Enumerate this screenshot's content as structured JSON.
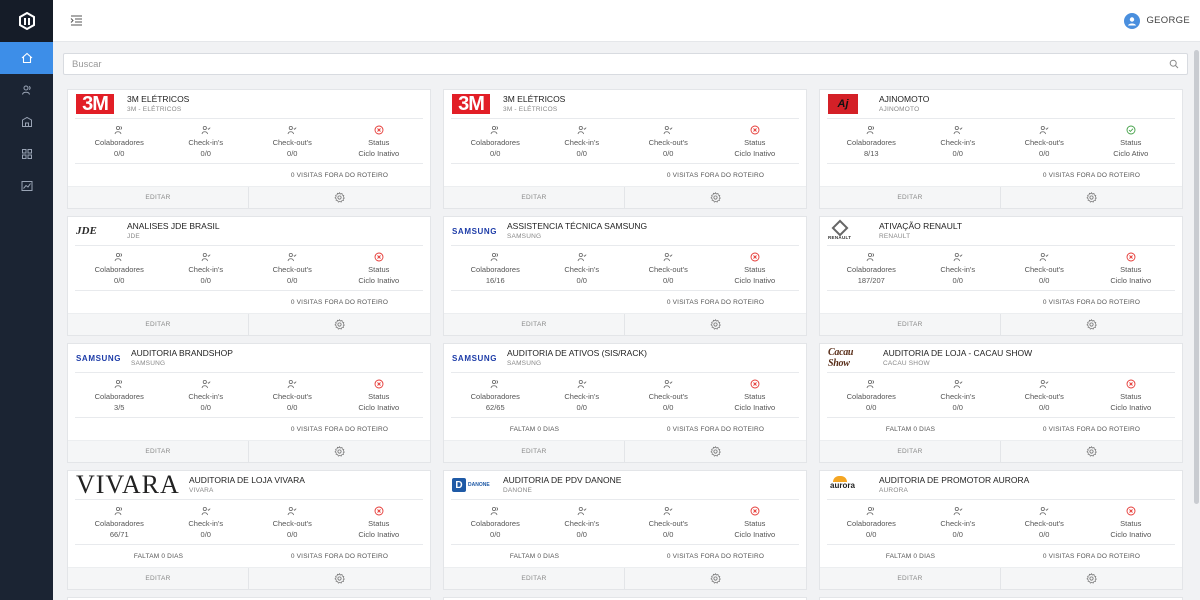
{
  "app": {
    "username": "GEORGE"
  },
  "search": {
    "placeholder": "Buscar",
    "value": ""
  },
  "labels": {
    "colaboradores": "Colaboradores",
    "checkins": "Check-in's",
    "checkouts": "Check-out's",
    "status": "Status",
    "editar": "EDITAR"
  },
  "colors": {
    "sidebar": "#1b2433",
    "accent": "#3d8ee8",
    "inactive": "#e53935",
    "active": "#43a047"
  },
  "cards": [
    {
      "logo": "3m",
      "title": "3M ELÉTRICOS",
      "subtitle": "3M - ELÉTRICOS",
      "colaboradores": "0/0",
      "checkins": "0/0",
      "checkouts": "0/0",
      "status_icon": "inactive",
      "status": "Ciclo Inativo",
      "left_info": "",
      "right_info": "0 VISITAS FORA DO ROTEIRO"
    },
    {
      "logo": "3m",
      "title": "3M ELÉTRICOS",
      "subtitle": "3M - ELÉTRICOS",
      "colaboradores": "0/0",
      "checkins": "0/0",
      "checkouts": "0/0",
      "status_icon": "inactive",
      "status": "Ciclo Inativo",
      "left_info": "",
      "right_info": "0 VISITAS FORA DO ROTEIRO"
    },
    {
      "logo": "aji",
      "title": "AJINOMOTO",
      "subtitle": "AJINOMOTO",
      "colaboradores": "8/13",
      "checkins": "0/0",
      "checkouts": "0/0",
      "status_icon": "active",
      "status": "Ciclo Ativo",
      "left_info": "",
      "right_info": "0 VISITAS FORA DO ROTEIRO"
    },
    {
      "logo": "jde",
      "title": "ANALISES JDE BRASIL",
      "subtitle": "JDE",
      "colaboradores": "0/0",
      "checkins": "0/0",
      "checkouts": "0/0",
      "status_icon": "inactive",
      "status": "Ciclo Inativo",
      "left_info": "",
      "right_info": "0 VISITAS FORA DO ROTEIRO"
    },
    {
      "logo": "samsung",
      "title": "ASSISTENCIA TÉCNICA SAMSUNG",
      "subtitle": "SAMSUNG",
      "colaboradores": "16/16",
      "checkins": "0/0",
      "checkouts": "0/0",
      "status_icon": "inactive",
      "status": "Ciclo Inativo",
      "left_info": "",
      "right_info": "0 VISITAS FORA DO ROTEIRO"
    },
    {
      "logo": "renault",
      "title": "ATIVAÇÃO RENAULT",
      "subtitle": "RENAULT",
      "colaboradores": "187/207",
      "checkins": "0/0",
      "checkouts": "0/0",
      "status_icon": "inactive",
      "status": "Ciclo Inativo",
      "left_info": "",
      "right_info": "0 VISITAS FORA DO ROTEIRO"
    },
    {
      "logo": "samsung",
      "title": "AUDITORIA BRANDSHOP",
      "subtitle": "SAMSUNG",
      "colaboradores": "3/5",
      "checkins": "0/0",
      "checkouts": "0/0",
      "status_icon": "inactive",
      "status": "Ciclo Inativo",
      "left_info": "",
      "right_info": "0 VISITAS FORA DO ROTEIRO"
    },
    {
      "logo": "samsung",
      "title": "AUDITORIA DE ATIVOS (SIS/RACK)",
      "subtitle": "SAMSUNG",
      "colaboradores": "62/65",
      "checkins": "0/0",
      "checkouts": "0/0",
      "status_icon": "inactive",
      "status": "Ciclo Inativo",
      "left_info": "FALTAM 0 DIAS",
      "right_info": "0 VISITAS FORA DO ROTEIRO"
    },
    {
      "logo": "cacau",
      "title": "AUDITORIA DE LOJA - CACAU SHOW",
      "subtitle": "CACAU SHOW",
      "colaboradores": "0/0",
      "checkins": "0/0",
      "checkouts": "0/0",
      "status_icon": "inactive",
      "status": "Ciclo Inativo",
      "left_info": "FALTAM 0 DIAS",
      "right_info": "0 VISITAS FORA DO ROTEIRO"
    },
    {
      "logo": "vivara",
      "title": "AUDITORIA DE LOJA VIVARA",
      "subtitle": "VIVARA",
      "colaboradores": "66/71",
      "checkins": "0/0",
      "checkouts": "0/0",
      "status_icon": "inactive",
      "status": "Ciclo Inativo",
      "left_info": "FALTAM 0 DIAS",
      "right_info": "0 VISITAS FORA DO ROTEIRO"
    },
    {
      "logo": "danone",
      "title": "AUDITORIA DE PDV DANONE",
      "subtitle": "DANONE",
      "colaboradores": "0/0",
      "checkins": "0/0",
      "checkouts": "0/0",
      "status_icon": "inactive",
      "status": "Ciclo Inativo",
      "left_info": "FALTAM 0 DIAS",
      "right_info": "0 VISITAS FORA DO ROTEIRO"
    },
    {
      "logo": "aurora",
      "title": "AUDITORIA DE PROMOTOR AURORA",
      "subtitle": "AURORA",
      "colaboradores": "0/0",
      "checkins": "0/0",
      "checkouts": "0/0",
      "status_icon": "inactive",
      "status": "Ciclo Inativo",
      "left_info": "FALTAM 0 DIAS",
      "right_info": "0 VISITAS FORA DO ROTEIRO"
    }
  ],
  "logo_text": {
    "3m": "3M",
    "aji": "Aj",
    "jde": "JDE",
    "samsung": "SAMSUNG",
    "renault": "RENAULT",
    "cacau": "Cacau Show",
    "vivara": "VIVARA",
    "danone": "D",
    "danone_t": "DANONE",
    "aurora": "aurora"
  }
}
